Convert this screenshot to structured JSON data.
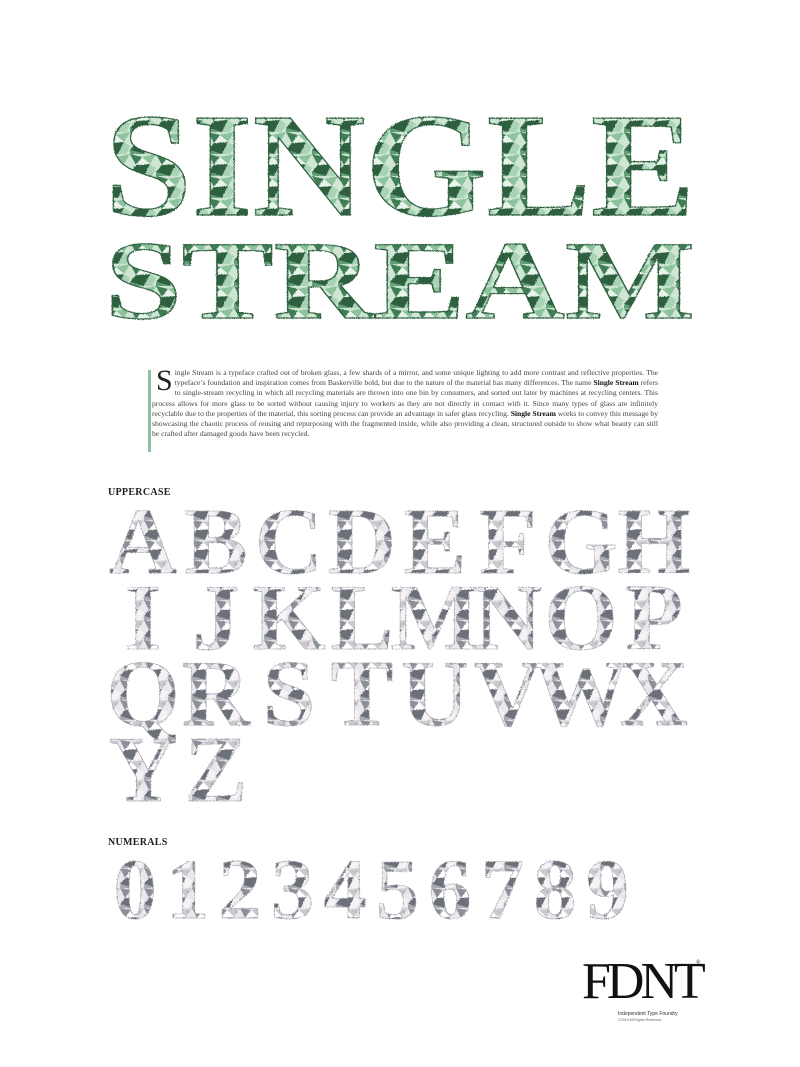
{
  "title": {
    "line1": "SINGLE",
    "line2": "STREAM"
  },
  "intro": {
    "drop_cap": "S",
    "part1": "ingle Stream is a typeface crafted out of broken glass, a few shards of a mirror, and some unique lighting to add more contrast and reflective properties. The typeface’s foundation and inspiration comes from Baskerville bold, but due to the nature of the material has many differences. The name ",
    "bold1": "Single Stream",
    "part2": " refers to single-stream recycling in which all recycling materials are thrown into one bin by consumers, and sorted out later by machines at recycling centers. This process allows for more glass to be sorted without causing injury to workers as they are not directly in contact with it. Since many types of glass are infinitely recyclable due to the properties of the material, this sorting process can provide an advantage in safer glass recycling. ",
    "bold2": "Single Stream",
    "part3": " works to convey this message by showcasing the chaotic process of reusing and repurposing with the fragmented inside, while also providing a clean, structured outside to show what beauty can still be crafted after damaged goods have been recycled."
  },
  "uppercase": {
    "label": "UPPERCASE",
    "rows": [
      [
        "A",
        "B",
        "C",
        "D",
        "E",
        "F",
        "G",
        "H"
      ],
      [
        "I",
        "J",
        "K",
        "L",
        "M",
        "N",
        "O",
        "P"
      ],
      [
        "Q",
        "R",
        "S",
        "T",
        "U",
        "V",
        "W",
        "X"
      ],
      [
        "Y",
        "Z"
      ]
    ]
  },
  "numerals": {
    "label": "NUMERALS",
    "rows": [
      [
        "0",
        "1",
        "2",
        "3",
        "4",
        "5",
        "6",
        "7",
        "8",
        "9"
      ]
    ]
  },
  "logo": {
    "mark": "FDNT",
    "registered": "®",
    "tagline": "Independent Type Foundry",
    "rights": "©2019 All Rights Reserved"
  },
  "colors": {
    "title_green": "#5f9e74",
    "title_dark": "#2f6140",
    "glyph_gray": "#aeb0b6",
    "accent_bar": "#8fc19f"
  }
}
